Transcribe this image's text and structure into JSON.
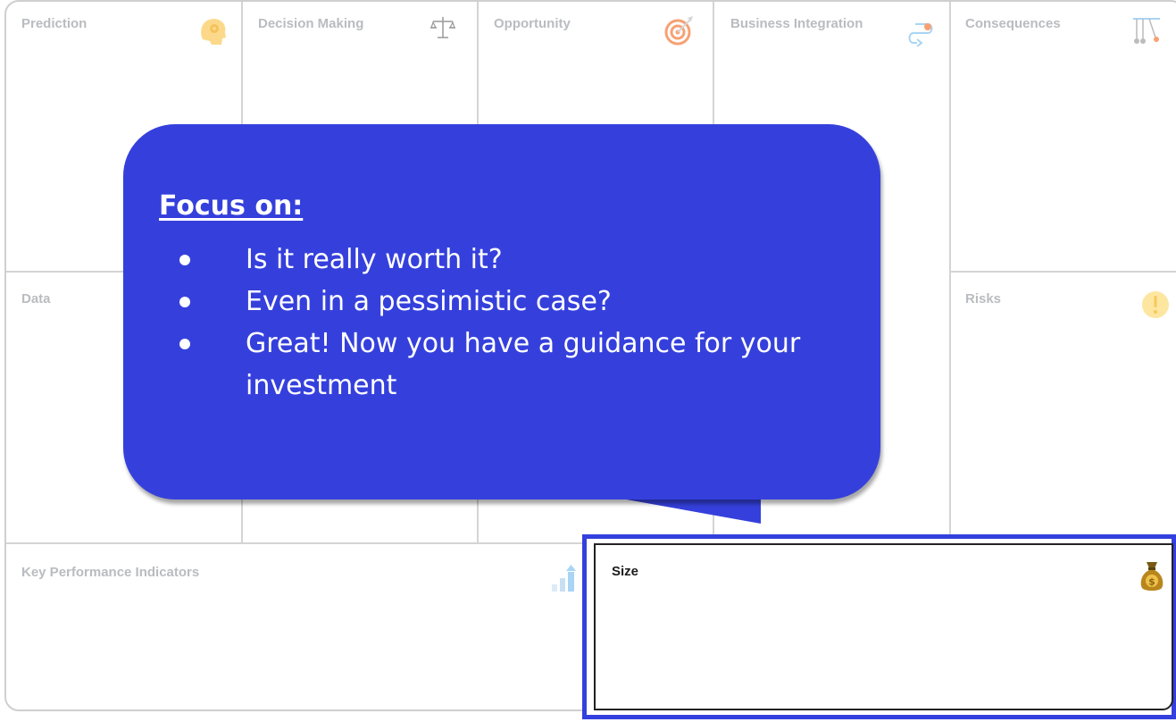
{
  "canvas": {
    "cells": {
      "prediction": "Prediction",
      "decision_making": "Decision Making",
      "opportunity": "Opportunity",
      "business_integration": "Business Integration",
      "consequences": "Consequences",
      "data": "Data",
      "risks": "Risks",
      "kpi": "Key Performance Indicators",
      "size": "Size"
    },
    "icons": {
      "prediction": "head-gear-icon",
      "decision_making": "scales-icon",
      "opportunity": "target-icon",
      "business_integration": "integration-arrow-icon",
      "consequences": "pendulum-icon",
      "risks": "warning-icon",
      "kpi": "growth-bars-icon",
      "size": "money-bag-icon"
    }
  },
  "callout": {
    "title": "Focus on:",
    "items": [
      "Is it really worth it?",
      "Even in a pessimistic case?",
      "Great! Now you have a guidance for your investment"
    ]
  },
  "colors": {
    "callout_bg": "#3540dc",
    "highlight_border": "#3340dd",
    "grid_line": "#d4d4d4",
    "faded_label": "#b9bcc0"
  }
}
